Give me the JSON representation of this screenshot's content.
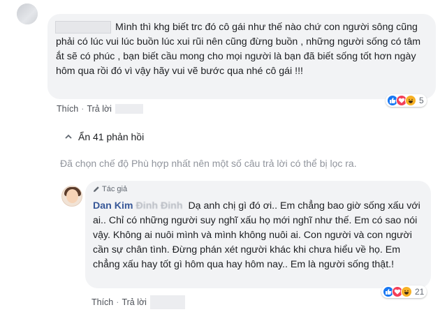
{
  "comment1": {
    "text": "Mình thì khg biết trc đó cô gái như thế nào chứ con người sông cũng phải có lúc vui lúc buồn lúc xui rũi nên cũng đừng buồn , những người sống có tâm ắt sẽ có phúc , bạn biết cầu mong cho mọi người là bạn đã biết sống tốt hơn ngày hôm qua rồi đó vì vậy hãy vui vẽ bước qua nhé cô gái !!!",
    "like_label": "Thích",
    "separator": "·",
    "reply_label": "Trả lời",
    "reactions": [
      "like-icon",
      "love-icon",
      "haha-icon"
    ],
    "reaction_count": "5"
  },
  "hidden_replies": {
    "label": "Ẩn 41 phản hồi"
  },
  "filter_note": "Đã chọn chế độ Phù hợp nhất nên một số câu trả lời có thể bị lọc ra.",
  "comment2": {
    "author_badge": "Tác giả",
    "author_name": "Dan Kim",
    "author_name_blurred": "Đinh Đinh",
    "text": "Dạ anh chị gì đó ơi.. Em chẳng bao giờ sống xấu với ai.. Chỉ có những người suy nghĩ xấu họ mới nghĩ như thế. Em có sao nói vậy. Không ai nuôi mình và mình không nuôi ai. Con người và con người cần sự chân tình. Đừng phán xét người khác khi chưa hiểu về họ. Em chẳng xấu hay tốt gì hôm qua hay hôm nay.. Em là người sống thật.!",
    "like_label": "Thích",
    "separator": "·",
    "reply_label": "Trả lời",
    "reactions": [
      "like-icon",
      "love-icon",
      "haha-icon"
    ],
    "reaction_count": "21"
  },
  "colors": {
    "bubble": "#f2f3f5",
    "link": "#385898",
    "muted": "#90949c",
    "like_blue": "#1877f2",
    "love_red": "#f33e58",
    "haha_yellow": "#f7b125"
  }
}
